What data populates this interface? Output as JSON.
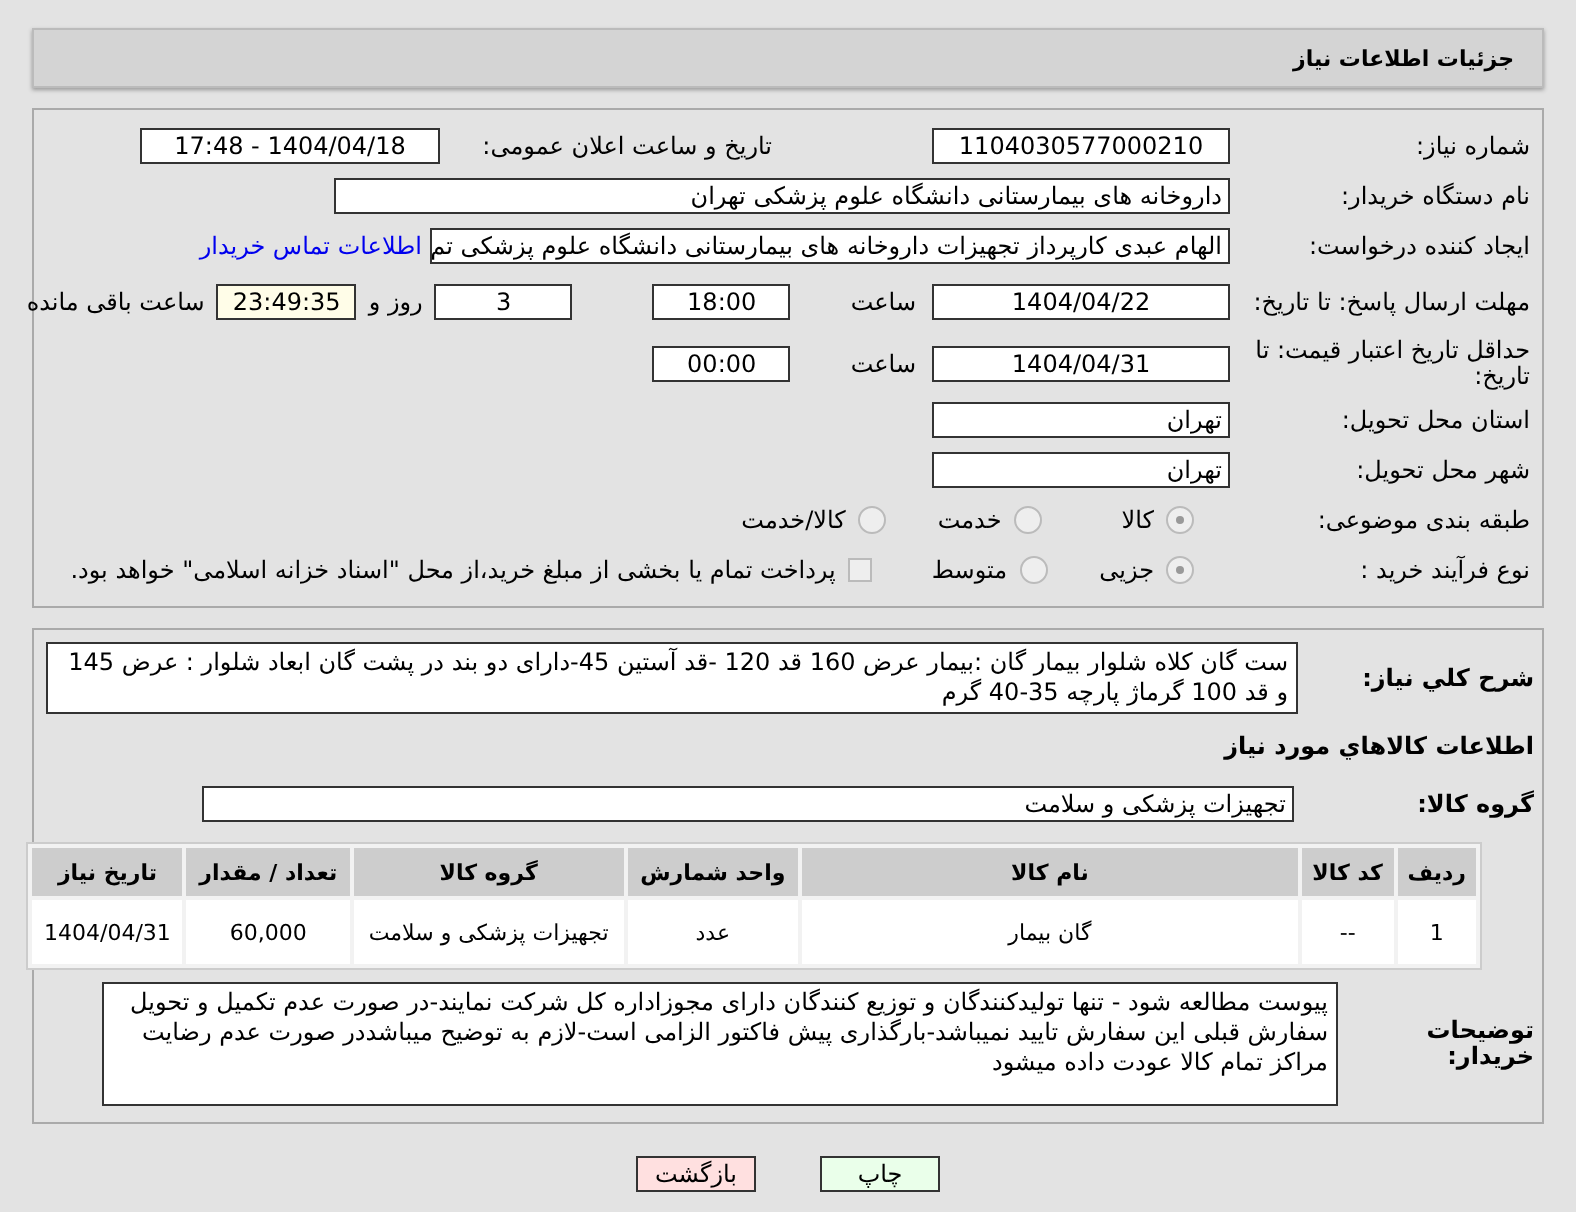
{
  "header": {
    "title": "جزئیات اطلاعات نیاز"
  },
  "need_number": {
    "label": "شماره نیاز:",
    "value": "1104030577000210"
  },
  "announce": {
    "label": "تاریخ و ساعت اعلان عمومی:",
    "value": "1404/04/18 - 17:48"
  },
  "buyer_org": {
    "label": "نام دستگاه خریدار:",
    "value": "داروخانه های بیمارستانی دانشگاه علوم پزشکی تهران"
  },
  "requester": {
    "label": "ایجاد کننده درخواست:",
    "value": "الهام عبدی کارپرداز تجهیزات داروخانه های بیمارستانی دانشگاه علوم پزشکی تم",
    "link": "اطلاعات تماس خریدار"
  },
  "deadline": {
    "label": "مهلت ارسال پاسخ: تا تاریخ:",
    "date": "1404/04/22",
    "time_label": "ساعت",
    "time": "18:00",
    "days": "3",
    "days_label": "روز و",
    "remaining": "23:49:35",
    "remaining_label": "ساعت باقی مانده"
  },
  "validity": {
    "label": "حداقل تاریخ اعتبار قیمت: تا تاریخ:",
    "date": "1404/04/31",
    "time_label": "ساعت",
    "time": "00:00"
  },
  "province": {
    "label": "استان محل تحویل:",
    "value": "تهران"
  },
  "city": {
    "label": "شهر محل تحویل:",
    "value": "تهران"
  },
  "category": {
    "label": "طبقه بندی موضوعی:",
    "options": [
      {
        "label": "کالا",
        "selected": true
      },
      {
        "label": "خدمت",
        "selected": false
      },
      {
        "label": "کالا/خدمت",
        "selected": false
      }
    ]
  },
  "process": {
    "label": "نوع فرآیند خرید :",
    "options": [
      {
        "label": "جزیی",
        "selected": true
      },
      {
        "label": "متوسط",
        "selected": false
      }
    ],
    "treasury": {
      "label": "پرداخت تمام یا بخشی از مبلغ خرید،از محل \"اسناد خزانه اسلامی\" خواهد بود.",
      "checked": false
    }
  },
  "description": {
    "label": "شرح کلي نياز:",
    "value": "ست گان کلاه شلوار بیمار گان :بیمار عرض 160 قد 120 -قد آستین 45-دارای دو بند در پشت گان ابعاد شلوار : عرض 145 و قد 100 گرماژ پارچه 35-40 گرم"
  },
  "goods_title": "اطلاعات كالاهاي مورد نياز",
  "goods_group": {
    "label": "گروه کالا:",
    "value": "تجهیزات پزشکی و سلامت"
  },
  "table": {
    "columns": [
      "ردیف",
      "کد کالا",
      "نام کالا",
      "واحد شمارش",
      "گروه کالا",
      "تعداد / مقدار",
      "تاریخ نیاز"
    ],
    "rows": [
      [
        "1",
        "--",
        "گان بیمار",
        "عدد",
        "تجهیزات پزشکی و سلامت",
        "60,000",
        "1404/04/31"
      ]
    ]
  },
  "buyer_notes": {
    "label": "توضیحات خریدار:",
    "value": "پیوست مطالعه شود - تنها تولیدکنندگان و توزیع کنندگان دارای مجوزاداره کل شرکت نمایند-در صورت عدم تکمیل و تحویل سفارش قبلی این سفارش تایید نمیباشد-بارگذاری پیش فاکتور الزامی است-لازم به توضیح میباشددر صورت عدم رضایت مراکز تمام کالا عودت داده میشود"
  },
  "buttons": [
    {
      "label": "چاپ",
      "kind": "print"
    },
    {
      "label": "بازگشت",
      "kind": "back"
    }
  ]
}
